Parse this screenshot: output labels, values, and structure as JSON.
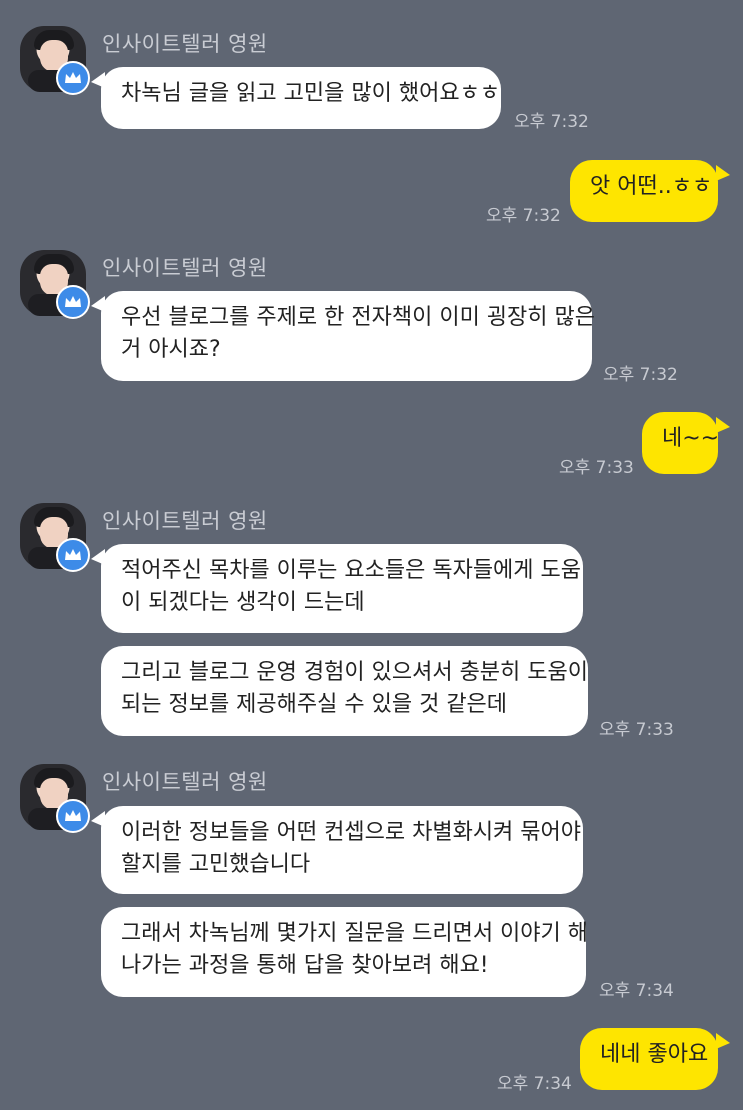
{
  "sender": {
    "name": "인사이트텔러 영원"
  },
  "messages": [
    {
      "from": "other",
      "text": "차녹님 글을 읽고 고민을 많이 했어요ㅎㅎ",
      "time": "오후 7:32"
    },
    {
      "from": "me",
      "text": "앗 어떤..ㅎㅎ",
      "time": "오후 7:32"
    },
    {
      "from": "other",
      "lines": [
        "우선 블로그를 주제로 한 전자책이 이미 굉장히 많은",
        "거 아시죠?"
      ],
      "time": "오후 7:32"
    },
    {
      "from": "me",
      "text": "네~~",
      "time": "오후 7:33"
    },
    {
      "from": "other",
      "lines": [
        "적어주신 목차를 이루는 요소들은 독자들에게 도움",
        "이 되겠다는 생각이 드는데"
      ]
    },
    {
      "from": "other",
      "lines": [
        "그리고 블로그 운영 경험이 있으셔서 충분히 도움이",
        "되는 정보를 제공해주실 수 있을 것 같은데"
      ],
      "time": "오후 7:33"
    },
    {
      "from": "other",
      "lines": [
        "이러한 정보들을 어떤 컨셉으로 차별화시켜 묶어야",
        "할지를 고민했습니다"
      ]
    },
    {
      "from": "other",
      "lines": [
        "그래서 차녹님께 몇가지 질문을 드리면서 이야기 해",
        "나가는 과정을 통해 답을 찾아보려 해요!"
      ],
      "time": "오후 7:34"
    },
    {
      "from": "me",
      "text": "네네 좋아요",
      "time": "오후 7:34"
    }
  ],
  "icons": {
    "avatar": "profile-photo",
    "badge": "crown-icon"
  },
  "colors": {
    "background": "#5f6673",
    "my_bubble": "#fee500",
    "other_bubble": "#ffffff",
    "badge": "#3d8be8"
  }
}
